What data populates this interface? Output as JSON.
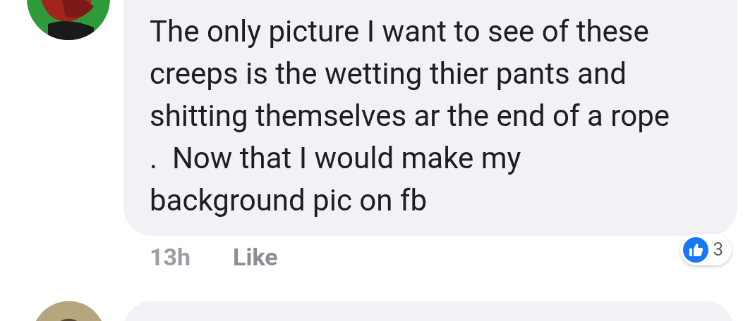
{
  "comments": [
    {
      "avatar": {
        "kind": "picture"
      },
      "text": "The only picture I want to see of these creeps is the wetting thier pants and shitting themselves ar the end of a rope .  Now that I would make my background pic on fb",
      "time": "13h",
      "like_label": "Like",
      "reactions": {
        "count": "3"
      }
    },
    {
      "avatar": {
        "kind": "picture"
      }
    }
  ]
}
